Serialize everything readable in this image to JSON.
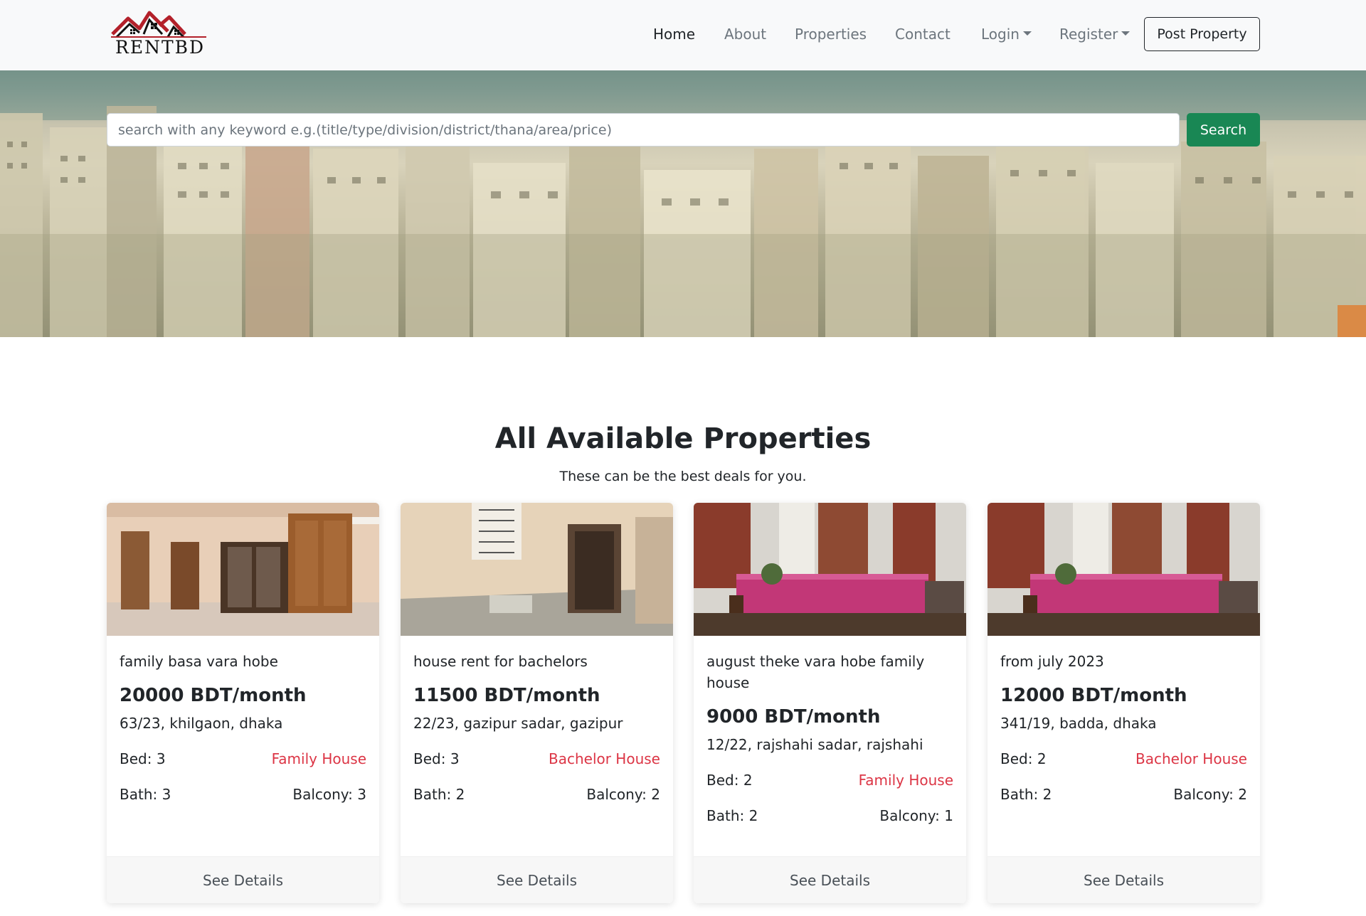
{
  "brand": {
    "name": "RentBD"
  },
  "nav": {
    "items": [
      {
        "label": "Home",
        "active": true
      },
      {
        "label": "About"
      },
      {
        "label": "Properties"
      },
      {
        "label": "Contact"
      },
      {
        "label": "Login",
        "dropdown": true
      },
      {
        "label": "Register",
        "dropdown": true
      }
    ],
    "post_label": "Post Property"
  },
  "search": {
    "placeholder": "search with any keyword e.g.(title/type/division/district/thana/area/price)",
    "button_label": "Search"
  },
  "section": {
    "title": "All Available Properties",
    "subtitle": "These can be the best deals for you."
  },
  "colors": {
    "accent_green": "#198754",
    "house_type_red": "#dc3545",
    "navbar_bg": "#f8f9fa"
  },
  "properties": [
    {
      "title": "family basa vara hobe",
      "price": "20000 BDT/month",
      "address": "63/23, khilgaon, dhaka",
      "bed": "Bed: 3",
      "type": "Family House",
      "bath": "Bath: 3",
      "balcony": "Balcony: 3",
      "details_label": "See Details"
    },
    {
      "title": "house rent for bachelors",
      "price": "11500 BDT/month",
      "address": "22/23, gazipur sadar, gazipur",
      "bed": "Bed: 3",
      "type": "Bachelor House",
      "bath": "Bath: 2",
      "balcony": "Balcony: 2",
      "details_label": "See Details"
    },
    {
      "title": "august theke vara hobe family house",
      "price": "9000 BDT/month",
      "address": "12/22, rajshahi sadar, rajshahi",
      "bed": "Bed: 2",
      "type": "Family House",
      "bath": "Bath: 2",
      "balcony": "Balcony: 1",
      "details_label": "See Details"
    },
    {
      "title": "from july 2023",
      "price": "12000 BDT/month",
      "address": "341/19, badda, dhaka",
      "bed": "Bed: 2",
      "type": "Bachelor House",
      "bath": "Bath: 2",
      "balcony": "Balcony: 2",
      "details_label": "See Details"
    }
  ]
}
